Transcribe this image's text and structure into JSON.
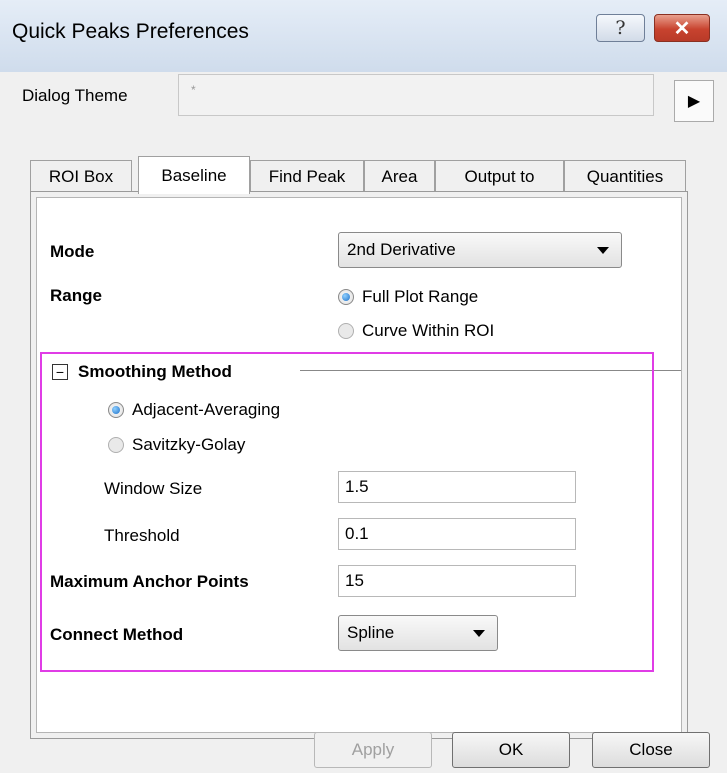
{
  "window": {
    "title": "Quick Peaks Preferences",
    "help_glyph": "?",
    "close_glyph": "✕"
  },
  "dialog_theme": {
    "label": "Dialog Theme",
    "value": "*",
    "arrow_glyph": "▶"
  },
  "tabs": [
    {
      "label": "ROI Box",
      "active": false
    },
    {
      "label": "Baseline",
      "active": true
    },
    {
      "label": "Find Peak",
      "active": false
    },
    {
      "label": "Area",
      "active": false
    },
    {
      "label": "Output to",
      "active": false
    },
    {
      "label": "Quantities",
      "active": false
    }
  ],
  "baseline": {
    "mode": {
      "label": "Mode",
      "value": "2nd Derivative"
    },
    "range": {
      "label": "Range",
      "options": [
        {
          "label": "Full Plot Range",
          "selected": true
        },
        {
          "label": "Curve Within ROI",
          "selected": false
        }
      ]
    },
    "smoothing": {
      "expander_glyph": "−",
      "label": "Smoothing Method",
      "options": [
        {
          "label": "Adjacent-Averaging",
          "selected": true
        },
        {
          "label": "Savitzky-Golay",
          "selected": false
        }
      ],
      "window_size": {
        "label": "Window Size",
        "value": "1.5"
      },
      "threshold": {
        "label": "Threshold",
        "value": "0.1"
      }
    },
    "max_anchor_points": {
      "label": "Maximum Anchor Points",
      "value": "15"
    },
    "connect_method": {
      "label": "Connect Method",
      "value": "Spline"
    }
  },
  "buttons": {
    "apply": "Apply",
    "ok": "OK",
    "close": "Close"
  },
  "colors": {
    "highlight": "#e03ce6",
    "title_bg": "#dce6f2",
    "close_button": "#c8432f"
  }
}
